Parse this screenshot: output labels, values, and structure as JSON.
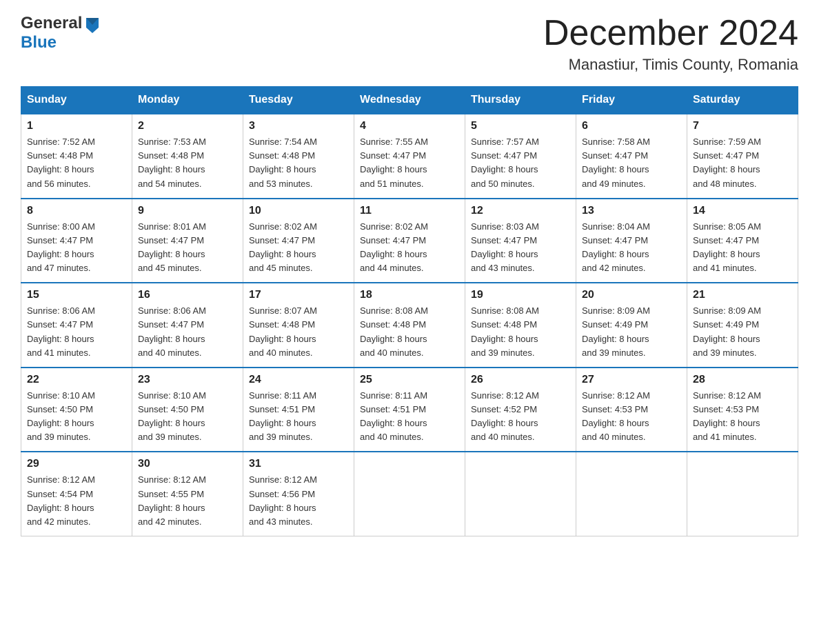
{
  "header": {
    "logo_general": "General",
    "logo_blue": "Blue",
    "title": "December 2024",
    "subtitle": "Manastiur, Timis County, Romania"
  },
  "days_of_week": [
    "Sunday",
    "Monday",
    "Tuesday",
    "Wednesday",
    "Thursday",
    "Friday",
    "Saturday"
  ],
  "weeks": [
    [
      {
        "day": "1",
        "sunrise": "7:52 AM",
        "sunset": "4:48 PM",
        "daylight": "8 hours and 56 minutes."
      },
      {
        "day": "2",
        "sunrise": "7:53 AM",
        "sunset": "4:48 PM",
        "daylight": "8 hours and 54 minutes."
      },
      {
        "day": "3",
        "sunrise": "7:54 AM",
        "sunset": "4:48 PM",
        "daylight": "8 hours and 53 minutes."
      },
      {
        "day": "4",
        "sunrise": "7:55 AM",
        "sunset": "4:47 PM",
        "daylight": "8 hours and 51 minutes."
      },
      {
        "day": "5",
        "sunrise": "7:57 AM",
        "sunset": "4:47 PM",
        "daylight": "8 hours and 50 minutes."
      },
      {
        "day": "6",
        "sunrise": "7:58 AM",
        "sunset": "4:47 PM",
        "daylight": "8 hours and 49 minutes."
      },
      {
        "day": "7",
        "sunrise": "7:59 AM",
        "sunset": "4:47 PM",
        "daylight": "8 hours and 48 minutes."
      }
    ],
    [
      {
        "day": "8",
        "sunrise": "8:00 AM",
        "sunset": "4:47 PM",
        "daylight": "8 hours and 47 minutes."
      },
      {
        "day": "9",
        "sunrise": "8:01 AM",
        "sunset": "4:47 PM",
        "daylight": "8 hours and 45 minutes."
      },
      {
        "day": "10",
        "sunrise": "8:02 AM",
        "sunset": "4:47 PM",
        "daylight": "8 hours and 45 minutes."
      },
      {
        "day": "11",
        "sunrise": "8:02 AM",
        "sunset": "4:47 PM",
        "daylight": "8 hours and 44 minutes."
      },
      {
        "day": "12",
        "sunrise": "8:03 AM",
        "sunset": "4:47 PM",
        "daylight": "8 hours and 43 minutes."
      },
      {
        "day": "13",
        "sunrise": "8:04 AM",
        "sunset": "4:47 PM",
        "daylight": "8 hours and 42 minutes."
      },
      {
        "day": "14",
        "sunrise": "8:05 AM",
        "sunset": "4:47 PM",
        "daylight": "8 hours and 41 minutes."
      }
    ],
    [
      {
        "day": "15",
        "sunrise": "8:06 AM",
        "sunset": "4:47 PM",
        "daylight": "8 hours and 41 minutes."
      },
      {
        "day": "16",
        "sunrise": "8:06 AM",
        "sunset": "4:47 PM",
        "daylight": "8 hours and 40 minutes."
      },
      {
        "day": "17",
        "sunrise": "8:07 AM",
        "sunset": "4:48 PM",
        "daylight": "8 hours and 40 minutes."
      },
      {
        "day": "18",
        "sunrise": "8:08 AM",
        "sunset": "4:48 PM",
        "daylight": "8 hours and 40 minutes."
      },
      {
        "day": "19",
        "sunrise": "8:08 AM",
        "sunset": "4:48 PM",
        "daylight": "8 hours and 39 minutes."
      },
      {
        "day": "20",
        "sunrise": "8:09 AM",
        "sunset": "4:49 PM",
        "daylight": "8 hours and 39 minutes."
      },
      {
        "day": "21",
        "sunrise": "8:09 AM",
        "sunset": "4:49 PM",
        "daylight": "8 hours and 39 minutes."
      }
    ],
    [
      {
        "day": "22",
        "sunrise": "8:10 AM",
        "sunset": "4:50 PM",
        "daylight": "8 hours and 39 minutes."
      },
      {
        "day": "23",
        "sunrise": "8:10 AM",
        "sunset": "4:50 PM",
        "daylight": "8 hours and 39 minutes."
      },
      {
        "day": "24",
        "sunrise": "8:11 AM",
        "sunset": "4:51 PM",
        "daylight": "8 hours and 39 minutes."
      },
      {
        "day": "25",
        "sunrise": "8:11 AM",
        "sunset": "4:51 PM",
        "daylight": "8 hours and 40 minutes."
      },
      {
        "day": "26",
        "sunrise": "8:12 AM",
        "sunset": "4:52 PM",
        "daylight": "8 hours and 40 minutes."
      },
      {
        "day": "27",
        "sunrise": "8:12 AM",
        "sunset": "4:53 PM",
        "daylight": "8 hours and 40 minutes."
      },
      {
        "day": "28",
        "sunrise": "8:12 AM",
        "sunset": "4:53 PM",
        "daylight": "8 hours and 41 minutes."
      }
    ],
    [
      {
        "day": "29",
        "sunrise": "8:12 AM",
        "sunset": "4:54 PM",
        "daylight": "8 hours and 42 minutes."
      },
      {
        "day": "30",
        "sunrise": "8:12 AM",
        "sunset": "4:55 PM",
        "daylight": "8 hours and 42 minutes."
      },
      {
        "day": "31",
        "sunrise": "8:12 AM",
        "sunset": "4:56 PM",
        "daylight": "8 hours and 43 minutes."
      },
      null,
      null,
      null,
      null
    ]
  ],
  "labels": {
    "sunrise": "Sunrise: ",
    "sunset": "Sunset: ",
    "daylight": "Daylight: "
  }
}
